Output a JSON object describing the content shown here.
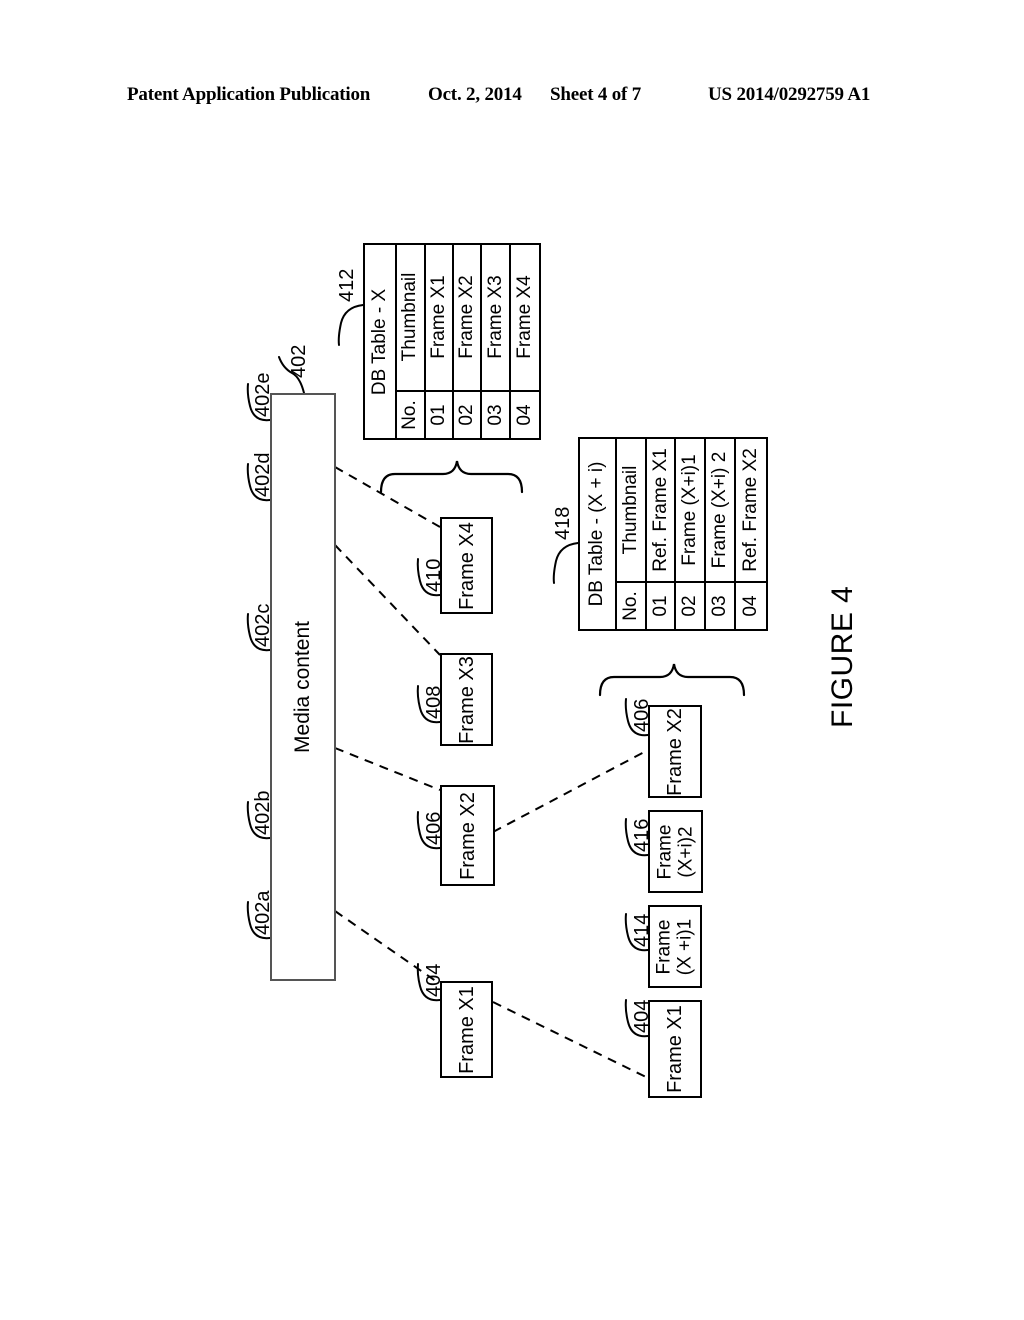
{
  "header": {
    "publication": "Patent Application Publication",
    "date": "Oct. 2, 2014",
    "sheet": "Sheet 4 of 7",
    "patent_number": "US 2014/0292759 A1"
  },
  "figure": {
    "caption": "FIGURE 4"
  },
  "media_content": {
    "label": "Media content",
    "ref": "402",
    "segment_refs": [
      "402a",
      "402b",
      "402c",
      "402d",
      "402e"
    ]
  },
  "tables": [
    {
      "ref": "412",
      "title": "DB Table - X",
      "headers": [
        "No.",
        "Thumbnail"
      ],
      "rows": [
        {
          "no": "01",
          "thumbnail": "Frame X1"
        },
        {
          "no": "02",
          "thumbnail": "Frame X2"
        },
        {
          "no": "03",
          "thumbnail": "Frame X3"
        },
        {
          "no": "04",
          "thumbnail": "Frame X4"
        }
      ]
    },
    {
      "ref": "418",
      "title": "DB Table - (X + i)",
      "headers": [
        "No.",
        "Thumbnail"
      ],
      "rows": [
        {
          "no": "01",
          "thumbnail": "Ref. Frame X1"
        },
        {
          "no": "02",
          "thumbnail": "Frame (X+i)1"
        },
        {
          "no": "03",
          "thumbnail": "Frame (X+i) 2"
        },
        {
          "no": "04",
          "thumbnail": "Ref. Frame X2"
        }
      ]
    }
  ],
  "frames_middle": [
    {
      "ref": "404",
      "label": "Frame X1"
    },
    {
      "ref": "406",
      "label": "Frame X2"
    },
    {
      "ref": "408",
      "label": "Frame X3"
    },
    {
      "ref": "410",
      "label": "Frame X4"
    }
  ],
  "frames_bottom": [
    {
      "ref": "404",
      "label": "Frame X1",
      "line1": "Frame X1",
      "line2": ""
    },
    {
      "ref": "414",
      "label": "Frame (X +i)1",
      "line1": "Frame",
      "line2": "(X +i)1"
    },
    {
      "ref": "416",
      "label": "Frame (X+i)2",
      "line1": "Frame",
      "line2": "(X+i)2"
    },
    {
      "ref": "406",
      "label": "Frame X2",
      "line1": "Frame X2",
      "line2": ""
    }
  ],
  "colors": {
    "line": "#000000",
    "background": "#ffffff",
    "media_bar_border": "#555555"
  }
}
